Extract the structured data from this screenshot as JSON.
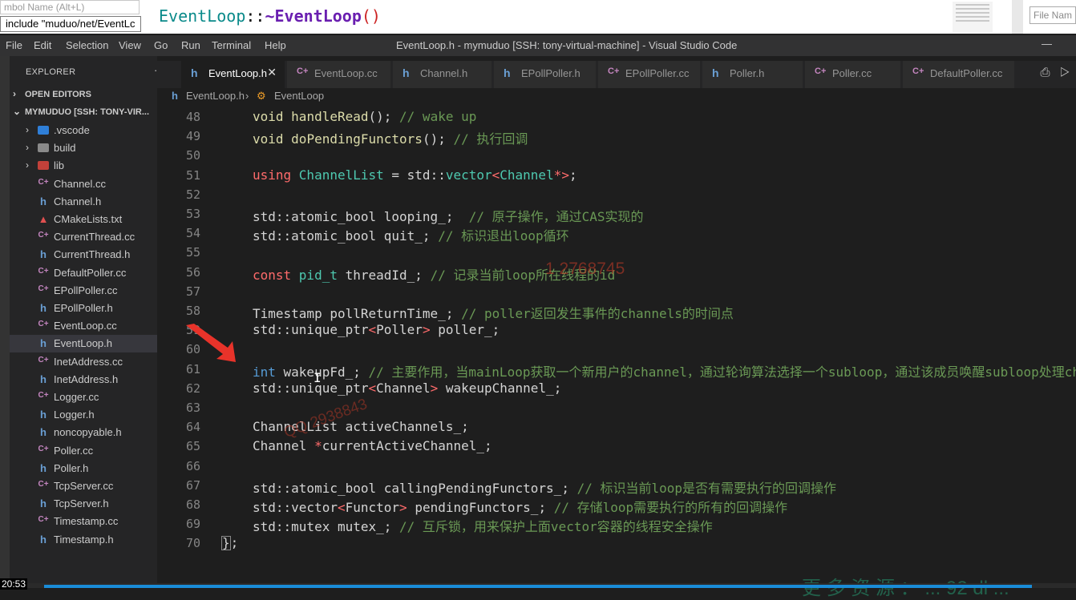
{
  "top_strip": {
    "symbol_placeholder": "mbol Name (Alt+L)",
    "include_text": "include \"muduo/net/EventLc",
    "destructor_class": "EventLoop",
    "destructor_sep": "::",
    "destructor_name": "~EventLoop",
    "destructor_parens": "()",
    "file_name_placeholder": "File Nam"
  },
  "menubar": {
    "items": [
      "File",
      "Edit",
      "Selection",
      "View",
      "Go",
      "Run",
      "Terminal",
      "Help"
    ],
    "window_title": "EventLoop.h - mymuduo [SSH: tony-virtual-machine] - Visual Studio Code",
    "minimize": "—"
  },
  "sidebar": {
    "title": "EXPLORER",
    "more": "···",
    "open_editors": "OPEN EDITORS",
    "workspace": "MYMUDUO [SSH: TONY-VIR...",
    "folders": [
      {
        "name": ".vscode",
        "color": "#2f7fd8"
      },
      {
        "name": "build",
        "color": "#8a8a8a"
      },
      {
        "name": "lib",
        "color": "#c2413a"
      }
    ],
    "files": [
      {
        "name": "Channel.cc",
        "icon": "C++",
        "icon_color": "#c586c0"
      },
      {
        "name": "Channel.h",
        "icon": "h",
        "icon_color": "#6a9fd4"
      },
      {
        "name": "CMakeLists.txt",
        "icon": "▲",
        "icon_color": "#e05050"
      },
      {
        "name": "CurrentThread.cc",
        "icon": "C++",
        "icon_color": "#c586c0"
      },
      {
        "name": "CurrentThread.h",
        "icon": "h",
        "icon_color": "#6a9fd4"
      },
      {
        "name": "DefaultPoller.cc",
        "icon": "C++",
        "icon_color": "#c586c0"
      },
      {
        "name": "EPollPoller.cc",
        "icon": "C++",
        "icon_color": "#c586c0"
      },
      {
        "name": "EPollPoller.h",
        "icon": "h",
        "icon_color": "#6a9fd4"
      },
      {
        "name": "EventLoop.cc",
        "icon": "C++",
        "icon_color": "#c586c0"
      },
      {
        "name": "EventLoop.h",
        "icon": "h",
        "icon_color": "#6a9fd4",
        "selected": true
      },
      {
        "name": "InetAddress.cc",
        "icon": "C++",
        "icon_color": "#c586c0"
      },
      {
        "name": "InetAddress.h",
        "icon": "h",
        "icon_color": "#6a9fd4"
      },
      {
        "name": "Logger.cc",
        "icon": "C++",
        "icon_color": "#c586c0"
      },
      {
        "name": "Logger.h",
        "icon": "h",
        "icon_color": "#6a9fd4"
      },
      {
        "name": "noncopyable.h",
        "icon": "h",
        "icon_color": "#6a9fd4"
      },
      {
        "name": "Poller.cc",
        "icon": "C++",
        "icon_color": "#c586c0"
      },
      {
        "name": "Poller.h",
        "icon": "h",
        "icon_color": "#6a9fd4"
      },
      {
        "name": "TcpServer.cc",
        "icon": "C++",
        "icon_color": "#c586c0"
      },
      {
        "name": "TcpServer.h",
        "icon": "h",
        "icon_color": "#6a9fd4"
      },
      {
        "name": "Timestamp.cc",
        "icon": "C++",
        "icon_color": "#c586c0"
      },
      {
        "name": "Timestamp.h",
        "icon": "h",
        "icon_color": "#6a9fd4"
      }
    ]
  },
  "tabs": [
    {
      "label": "EventLoop.h",
      "icon": "h",
      "icon_color": "#6a9fd4",
      "active": true
    },
    {
      "label": "EventLoop.cc",
      "icon": "C++",
      "icon_color": "#c586c0"
    },
    {
      "label": "Channel.h",
      "icon": "h",
      "icon_color": "#6a9fd4"
    },
    {
      "label": "EPollPoller.h",
      "icon": "h",
      "icon_color": "#6a9fd4"
    },
    {
      "label": "EPollPoller.cc",
      "icon": "C++",
      "icon_color": "#c586c0"
    },
    {
      "label": "Poller.h",
      "icon": "h",
      "icon_color": "#6a9fd4"
    },
    {
      "label": "Poller.cc",
      "icon": "C++",
      "icon_color": "#c586c0"
    },
    {
      "label": "DefaultPoller.cc",
      "icon": "C++",
      "icon_color": "#c586c0"
    }
  ],
  "tab_close": "✕",
  "breadcrumb": {
    "file": "EventLoop.h",
    "symbol": "EventLoop"
  },
  "editor": {
    "lines": [
      {
        "n": "48",
        "tokens": [
          [
            "fnc",
            "void "
          ],
          [
            "fnc",
            "handleRead"
          ],
          [
            "",
            "(); "
          ],
          [
            "cm",
            "// wake up"
          ]
        ]
      },
      {
        "n": "49",
        "tokens": [
          [
            "fnc",
            "void "
          ],
          [
            "fnc",
            "doPendingFunctors"
          ],
          [
            "",
            "(); "
          ],
          [
            "cm",
            "// 执行回调"
          ]
        ]
      },
      {
        "n": "50",
        "tokens": []
      },
      {
        "n": "51",
        "tokens": [
          [
            "pu",
            "using "
          ],
          [
            "ty",
            "ChannelList"
          ],
          [
            "",
            " = std::"
          ],
          [
            "ty",
            "vector"
          ],
          [
            "pu",
            "<"
          ],
          [
            "ty",
            "Channel"
          ],
          [
            "pu",
            "*>"
          ],
          [
            "",
            ";"
          ]
        ]
      },
      {
        "n": "52",
        "tokens": []
      },
      {
        "n": "53",
        "tokens": [
          [
            "",
            "std::atomic_bool looping_;  "
          ],
          [
            "cm",
            "// 原子操作，通过CAS实现的"
          ]
        ]
      },
      {
        "n": "54",
        "tokens": [
          [
            "",
            "std::atomic_bool quit_; "
          ],
          [
            "cm",
            "// 标识退出loop循环"
          ]
        ]
      },
      {
        "n": "55",
        "tokens": []
      },
      {
        "n": "56",
        "tokens": [
          [
            "pu",
            "const "
          ],
          [
            "ty",
            "pid_t"
          ],
          [
            "",
            " threadId_; "
          ],
          [
            "cm",
            "// 记录当前loop所在线程的id"
          ]
        ]
      },
      {
        "n": "57",
        "tokens": []
      },
      {
        "n": "58",
        "tokens": [
          [
            "",
            "Timestamp pollReturnTime_; "
          ],
          [
            "cm",
            "// poller返回发生事件的channels的时间点"
          ]
        ]
      },
      {
        "n": "59",
        "tokens": [
          [
            "",
            "std::unique_ptr"
          ],
          [
            "pu",
            "<"
          ],
          [
            "",
            "Poller"
          ],
          [
            "pu",
            "> "
          ],
          [
            "",
            "poller_;"
          ]
        ]
      },
      {
        "n": "60",
        "tokens": []
      },
      {
        "n": "61",
        "tokens": [
          [
            "kw",
            "int "
          ],
          [
            "",
            "wakeupFd_; "
          ],
          [
            "cm",
            "// 主要作用，当mainLoop获取一个新用户的channel，通过轮询算法选择一个subloop，通过该成员唤醒subloop处理channel"
          ]
        ]
      },
      {
        "n": "62",
        "tokens": [
          [
            "",
            "std::unique_ptr"
          ],
          [
            "pu",
            "<"
          ],
          [
            "",
            "Channel"
          ],
          [
            "pu",
            "> "
          ],
          [
            "",
            "wakeupChannel_;"
          ]
        ]
      },
      {
        "n": "63",
        "tokens": []
      },
      {
        "n": "64",
        "tokens": [
          [
            "",
            "ChannelList activeChannels_;"
          ]
        ]
      },
      {
        "n": "65",
        "tokens": [
          [
            "",
            "Channel "
          ],
          [
            "pu",
            "*"
          ],
          [
            "",
            "currentActiveChannel_;"
          ]
        ]
      },
      {
        "n": "66",
        "tokens": []
      },
      {
        "n": "67",
        "tokens": [
          [
            "",
            "std::atomic_bool callingPendingFunctors_; "
          ],
          [
            "cm",
            "// 标识当前loop是否有需要执行的回调操作"
          ]
        ]
      },
      {
        "n": "68",
        "tokens": [
          [
            "",
            "std::vector"
          ],
          [
            "pu",
            "<"
          ],
          [
            "",
            "Functor"
          ],
          [
            "pu",
            "> "
          ],
          [
            "",
            "pendingFunctors_; "
          ],
          [
            "cm",
            "// 存储loop需要执行的所有的回调操作"
          ]
        ]
      },
      {
        "n": "69",
        "tokens": [
          [
            "",
            "std::mutex mutex_; "
          ],
          [
            "cm",
            "// 互斥锁，用来保护上面vector容器的线程安全操作"
          ]
        ]
      },
      {
        "n": "70",
        "tokens": [
          [
            "brace",
            "}"
          ],
          [
            "",
            ";"
          ]
        ]
      }
    ]
  },
  "watermarks": {
    "number": "1 2768745",
    "qq": "QQ 2938843",
    "resource": "更 多 资 源 ： ... 92 dl ..."
  },
  "video": {
    "timestamp": "20:53",
    "progress": 0.957
  }
}
